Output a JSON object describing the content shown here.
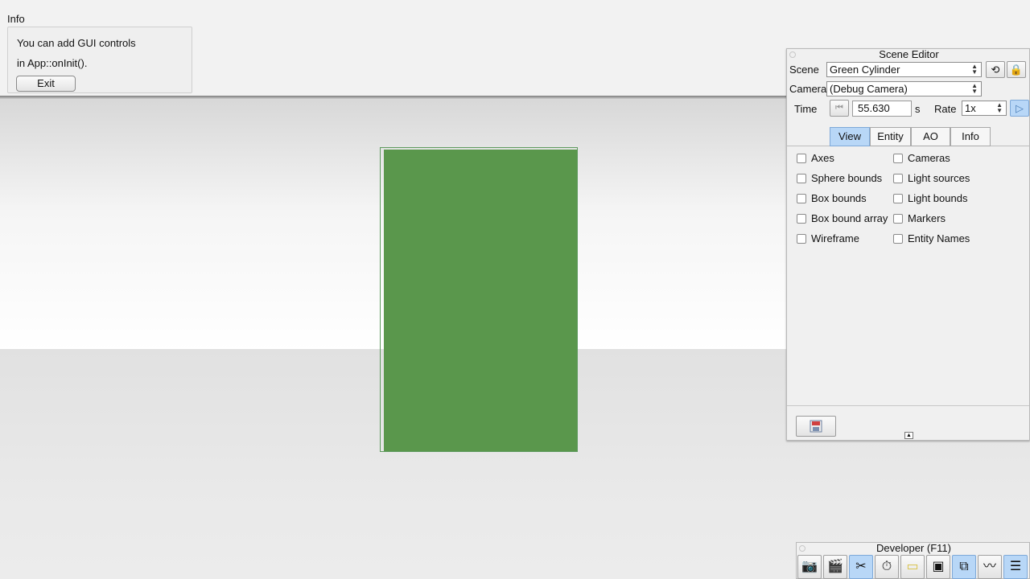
{
  "info": {
    "title": "Info",
    "line1": "You can add GUI controls",
    "line2": "in App::onInit().",
    "exit_label": "Exit"
  },
  "scene_editor": {
    "title": "Scene Editor",
    "scene_label": "Scene",
    "scene_value": "Green Cylinder",
    "camera_label": "Camera",
    "camera_value": "(Debug Camera)",
    "time_label": "Time",
    "time_value": "55.630",
    "time_unit": "s",
    "rate_label": "Rate",
    "rate_value": "1x",
    "tabs": [
      {
        "label": "View",
        "active": true
      },
      {
        "label": "Entity",
        "active": false
      },
      {
        "label": "AO",
        "active": false
      },
      {
        "label": "Info",
        "active": false
      }
    ],
    "checkboxes_left": [
      "Axes",
      "Sphere bounds",
      "Box bounds",
      "Box bound array",
      "Wireframe"
    ],
    "checkboxes_right": [
      "Cameras",
      "Light sources",
      "Light bounds",
      "Markers",
      "Entity Names"
    ]
  },
  "developer": {
    "title": "Developer (F11)",
    "tools": [
      "camera-icon",
      "clapperboard-icon",
      "tools-icon",
      "clock-icon",
      "note-icon",
      "terminal-icon",
      "windows-icon",
      "profiler-icon",
      "log-icon"
    ]
  },
  "colors": {
    "cylinder": "#5a974c",
    "active_tab": "#b8d7f7"
  }
}
